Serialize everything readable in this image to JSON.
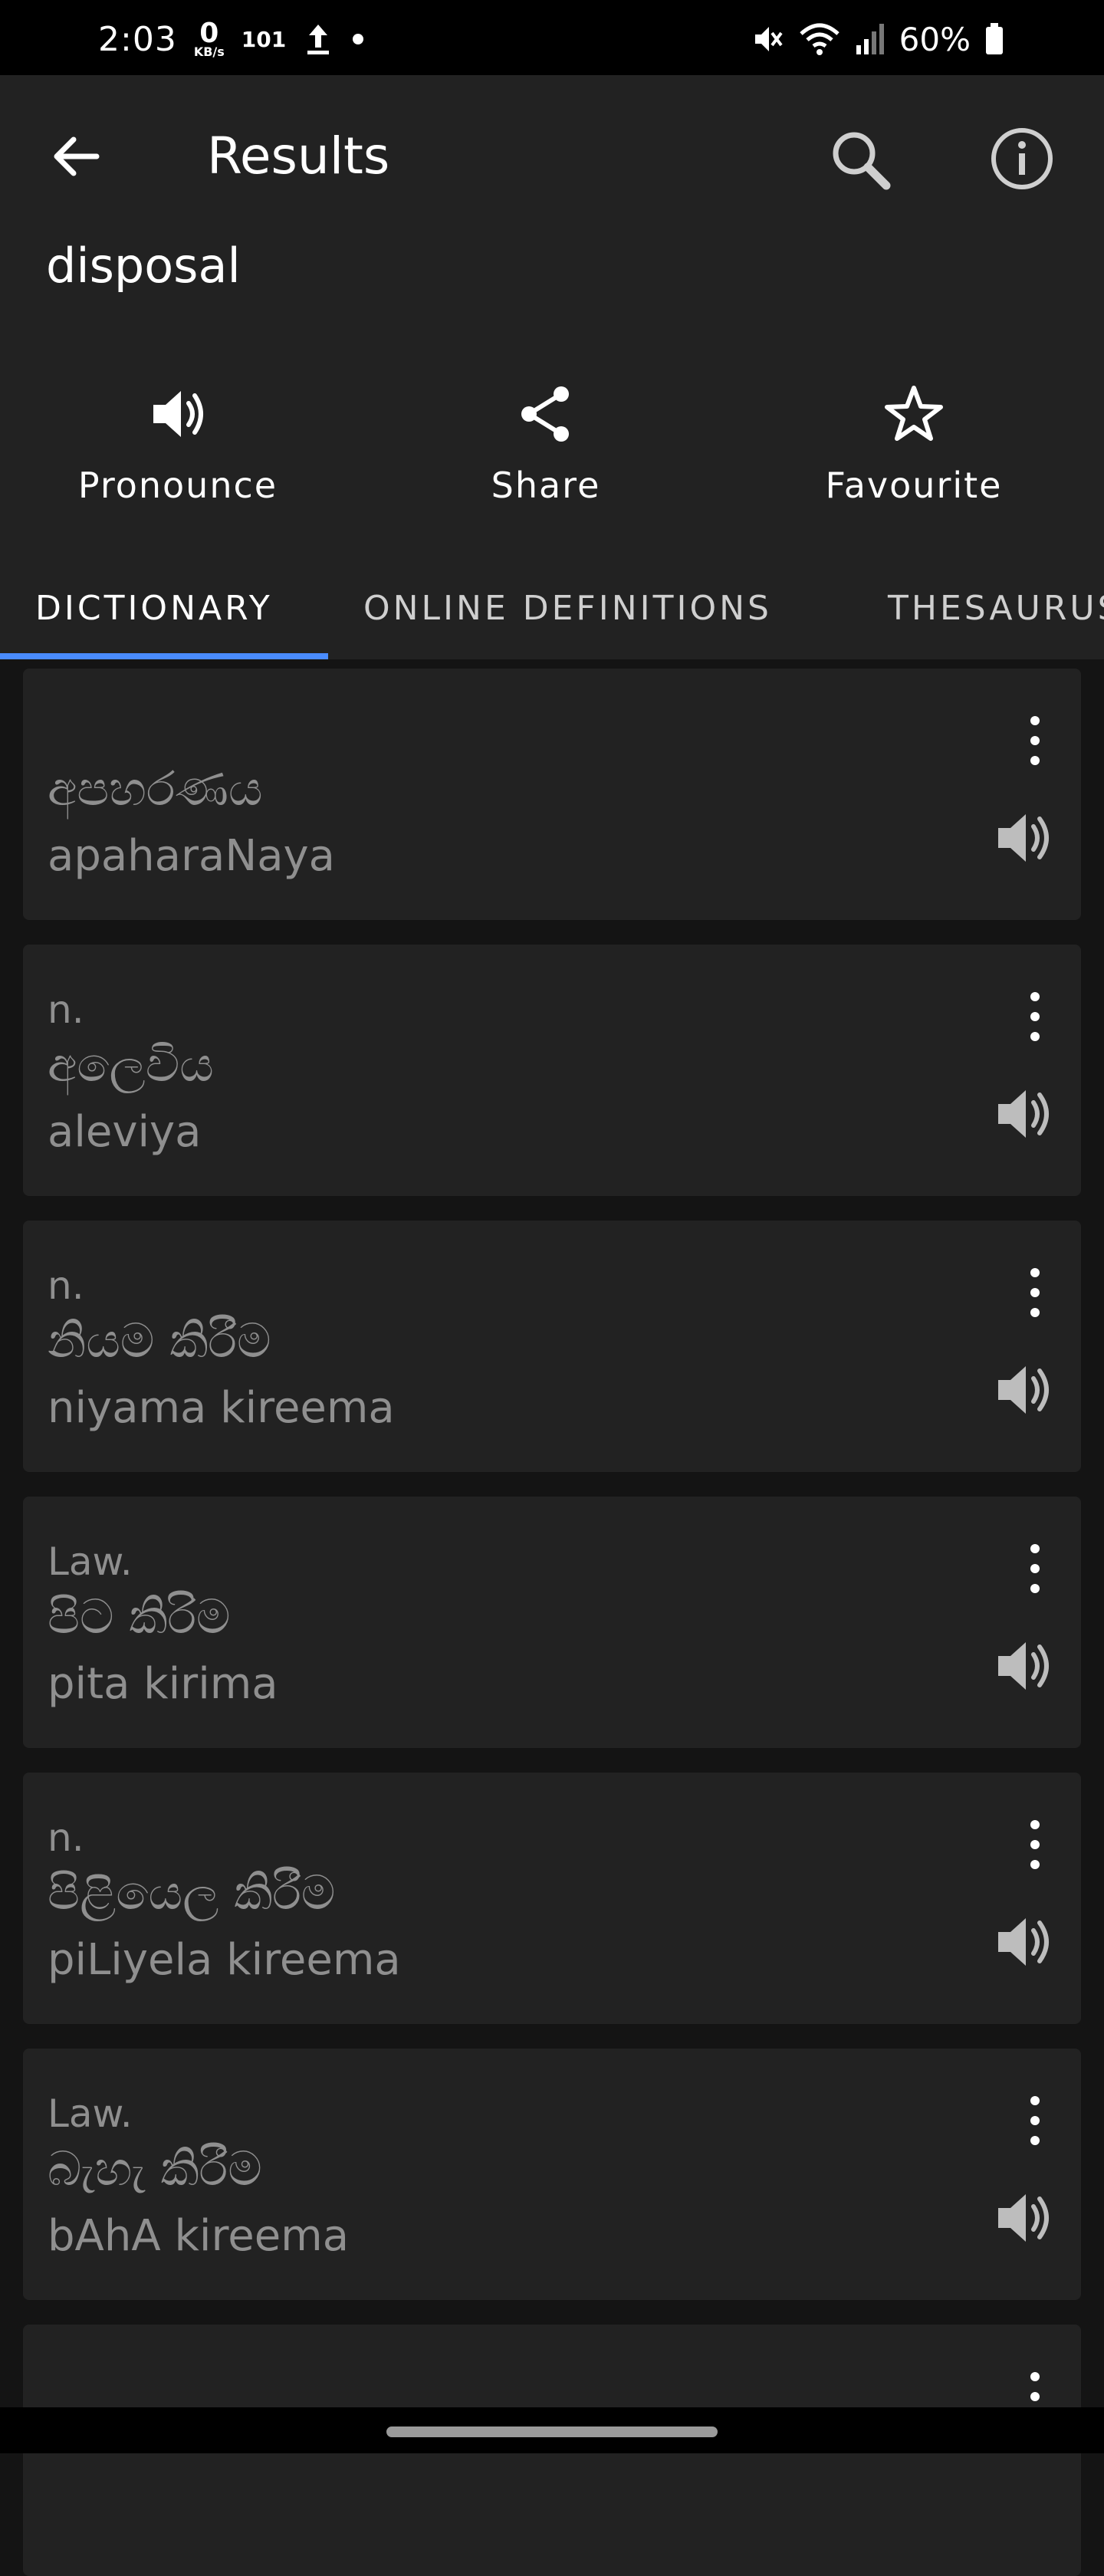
{
  "status": {
    "time": "2:03",
    "speed_value": "0",
    "speed_unit": "KB/s",
    "indicator": "101",
    "battery": "60%",
    "icons": [
      "upload-arrow-icon",
      "dot-icon",
      "mute-icon",
      "wifi-icon",
      "signal-icon",
      "battery-icon"
    ]
  },
  "appbar": {
    "title": "Results",
    "query": "disposal"
  },
  "actions": {
    "pronounce": "Pronounce",
    "share": "Share",
    "favourite": "Favourite"
  },
  "tabs": [
    {
      "label": "DICTIONARY"
    },
    {
      "label": "ONLINE DEFINITIONS"
    },
    {
      "label": "THESAURUS"
    }
  ],
  "results": [
    {
      "pos": "",
      "word": "අපහරණය",
      "translit": "apaharaNaya"
    },
    {
      "pos": "n.",
      "word": "අලෙවිය",
      "translit": "aleviya"
    },
    {
      "pos": "n.",
      "word": "නියම කිරීම",
      "translit": "niyama kireema"
    },
    {
      "pos": "Law.",
      "word": "පිට කිරිම",
      "translit": "pita kirima"
    },
    {
      "pos": "n.",
      "word": "පිළියෙල කිරීම",
      "translit": "piLiyela kireema"
    },
    {
      "pos": "Law.",
      "word": "බැහැ කිරීම",
      "translit": "bAhA kireema"
    },
    {
      "pos": "",
      "word": "",
      "translit": ""
    }
  ],
  "colors": {
    "accent": "#4a8cff",
    "background": "#141414",
    "surface": "#222222",
    "muted_text": "#8f8f8f"
  }
}
